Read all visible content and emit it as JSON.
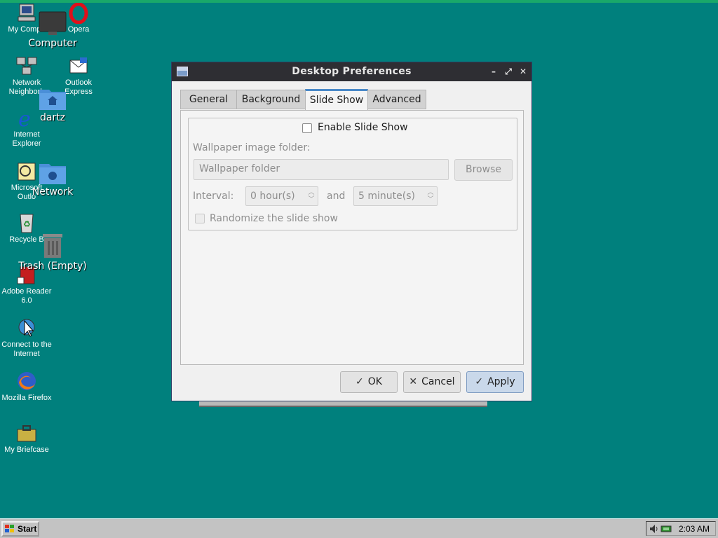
{
  "desktop": {
    "classic_icons": [
      {
        "label": "My Compu",
        "icon": "my-computer-icon"
      },
      {
        "label": "Opera",
        "icon": "opera-icon"
      },
      {
        "label": "Network\nNeighborh",
        "icon": "network-neighborhood-icon"
      },
      {
        "label": "Outlook\nExpress",
        "icon": "outlook-express-icon"
      },
      {
        "label": "Internet\nExplorer",
        "icon": "internet-explorer-icon"
      },
      {
        "label": "Microsoft\nOutlo",
        "icon": "microsoft-outlook-icon"
      },
      {
        "label": "Recycle B",
        "icon": "recycle-bin-icon"
      },
      {
        "label": "Adobe Reader\n6.0",
        "icon": "adobe-reader-icon"
      },
      {
        "label": "Connect to the\nInternet",
        "icon": "connect-internet-icon"
      },
      {
        "label": "Mozilla Firefox",
        "icon": "firefox-icon"
      },
      {
        "label": "My Briefcase",
        "icon": "briefcase-icon"
      }
    ],
    "overlay_icons": [
      {
        "label": "Computer",
        "icon": "computer-monitor-icon"
      },
      {
        "label": "dartz",
        "icon": "home-folder-icon"
      },
      {
        "label": "Network",
        "icon": "network-folder-icon"
      },
      {
        "label": "Trash (Empty)",
        "icon": "trash-icon"
      }
    ]
  },
  "dialog": {
    "title": "Desktop Preferences",
    "tabs": [
      {
        "label": "General",
        "active": false
      },
      {
        "label": "Background",
        "active": false
      },
      {
        "label": "Slide Show",
        "active": true
      },
      {
        "label": "Advanced",
        "active": false
      }
    ],
    "slideshow": {
      "enable_label": "Enable Slide Show",
      "enable_checked": false,
      "folder_label": "Wallpaper image folder:",
      "folder_placeholder": "Wallpaper folder",
      "browse_label": "Browse",
      "interval_label": "Interval:",
      "hours_value": "0 hour(s)",
      "and_label": "and",
      "minutes_value": "5 minute(s)",
      "randomize_label": "Randomize the slide show",
      "randomize_checked": false
    },
    "buttons": {
      "ok": "OK",
      "cancel": "Cancel",
      "apply": "Apply"
    }
  },
  "taskbar": {
    "start_label": "Start",
    "clock": "2:03 AM"
  },
  "colors": {
    "desktop_bg": "#00807d",
    "titlebar_bg": "#2e2e33",
    "active_tab_accent": "#4a89c8",
    "apply_button_bg": "#c9d8ea"
  }
}
